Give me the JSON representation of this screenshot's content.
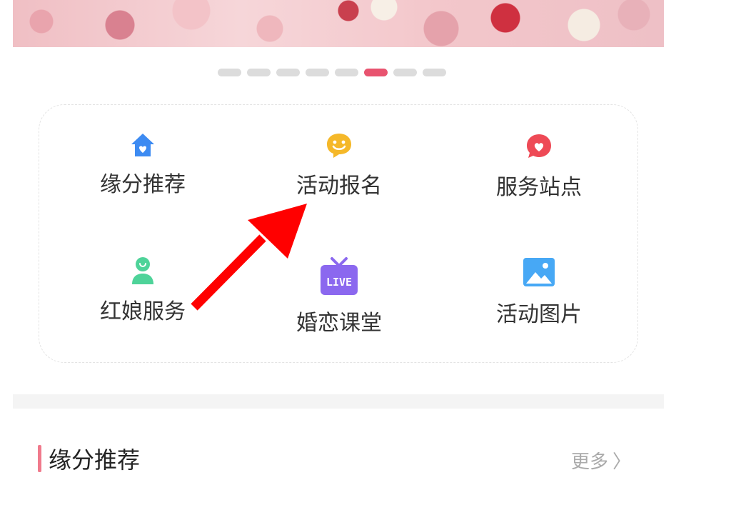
{
  "carousel": {
    "dot_count": 8,
    "active_index": 5
  },
  "menu": {
    "items": [
      {
        "label": "缘分推荐",
        "icon": "house-heart-icon",
        "color": "#3d8bf2"
      },
      {
        "label": "活动报名",
        "icon": "smiley-chat-icon",
        "color": "#f5b829"
      },
      {
        "label": "服务站点",
        "icon": "heart-bubble-icon",
        "color": "#ee4a56"
      },
      {
        "label": "红娘服务",
        "icon": "user-icon",
        "color": "#4ed399"
      },
      {
        "label": "婚恋课堂",
        "icon": "live-tv-icon",
        "color": "#8b68ef",
        "badge": "LIVE"
      },
      {
        "label": "活动图片",
        "icon": "picture-icon",
        "color": "#47a8f5"
      }
    ]
  },
  "section": {
    "title": "缘分推荐",
    "more_label": "更多",
    "more_chevron": "〉",
    "accent_color": "#f07a8c"
  },
  "annotation": {
    "arrow_color": "#ff0000"
  }
}
